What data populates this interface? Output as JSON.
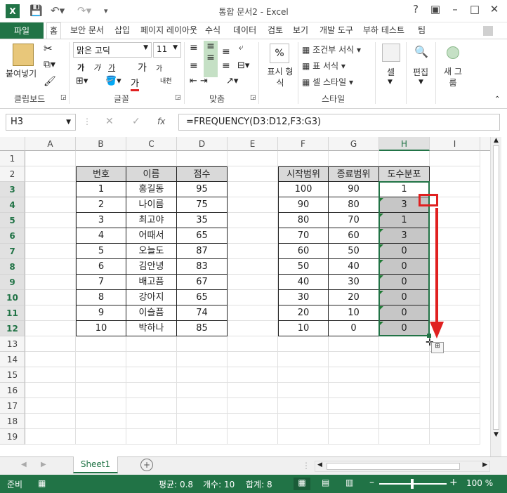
{
  "window": {
    "title": "통합 문서2 - Excel"
  },
  "tabs": [
    "파일",
    "홈",
    "보안 문서",
    "삽입",
    "페이지 레이아웃",
    "수식",
    "데이터",
    "검토",
    "보기",
    "개발 도구",
    "부하 테스트",
    "팀"
  ],
  "ribbon": {
    "clipboard": {
      "paste": "붙여넣기",
      "group": "클립보드"
    },
    "font": {
      "name": "맑은 고딕",
      "size": "11",
      "group": "글꼴",
      "bold": "가",
      "italic": "가",
      "underline": "가",
      "grow": "가",
      "shrink": "가",
      "fontcolor": "가",
      "phonetic": "내천"
    },
    "alignment": {
      "group": "맞춤"
    },
    "number": {
      "format": "표시 형식",
      "group": ""
    },
    "styles": {
      "conditional": "조건부 서식",
      "table": "표 서식",
      "cell_style": "셀 스타일",
      "group": "스타일"
    },
    "cells": {
      "label": "셀"
    },
    "editing": {
      "label": "편집"
    },
    "new_group": {
      "label": "새 그룹"
    }
  },
  "formula_bar": {
    "name_box": "H3",
    "formula": "=FREQUENCY(D3:D12,F3:G3)",
    "fx": "fx"
  },
  "columns": [
    "A",
    "B",
    "C",
    "D",
    "E",
    "F",
    "G",
    "H",
    "I"
  ],
  "rows": [
    "1",
    "2",
    "3",
    "4",
    "5",
    "6",
    "7",
    "8",
    "9",
    "10",
    "11",
    "12",
    "13",
    "14",
    "15",
    "16",
    "17",
    "18",
    "19"
  ],
  "table1": {
    "headers": [
      "번호",
      "이름",
      "점수"
    ],
    "rows": [
      [
        "1",
        "홍길동",
        "95"
      ],
      [
        "2",
        "나이름",
        "75"
      ],
      [
        "3",
        "최고야",
        "35"
      ],
      [
        "4",
        "어때서",
        "65"
      ],
      [
        "5",
        "오늘도",
        "87"
      ],
      [
        "6",
        "김안녕",
        "83"
      ],
      [
        "7",
        "배고픔",
        "67"
      ],
      [
        "8",
        "강아지",
        "65"
      ],
      [
        "9",
        "이슬픔",
        "74"
      ],
      [
        "10",
        "박하나",
        "85"
      ]
    ]
  },
  "table2": {
    "headers": [
      "시작범위",
      "종료범위",
      "도수분포"
    ],
    "rows": [
      [
        "100",
        "90",
        "1"
      ],
      [
        "90",
        "80",
        "3"
      ],
      [
        "80",
        "70",
        "1"
      ],
      [
        "70",
        "60",
        "3"
      ],
      [
        "60",
        "50",
        "0"
      ],
      [
        "50",
        "40",
        "0"
      ],
      [
        "40",
        "30",
        "0"
      ],
      [
        "30",
        "20",
        "0"
      ],
      [
        "20",
        "10",
        "0"
      ],
      [
        "10",
        "0",
        "0"
      ]
    ]
  },
  "sheet_tabs": [
    "Sheet1"
  ],
  "status": {
    "ready": "준비",
    "average": "평균: 0.8",
    "count": "개수: 10",
    "sum": "합계: 8",
    "zoom": "100 %"
  },
  "colors": {
    "accent": "#217346",
    "annotation": "#e02020"
  }
}
